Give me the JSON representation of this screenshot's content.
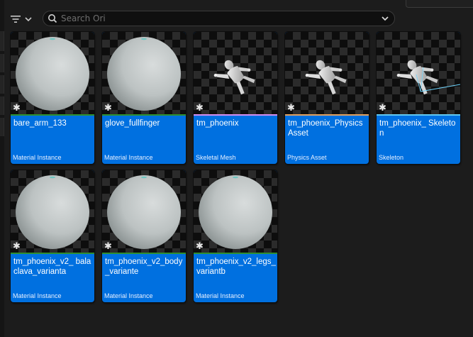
{
  "search": {
    "placeholder": "Search Ori",
    "value": ""
  },
  "toolbar": {
    "filter_icon": "filter-lines-icon",
    "dropdown_icon": "chevron-down-icon"
  },
  "colors": {
    "tile_bg": "#0070e0",
    "material_instance": "#2f8f2f",
    "skeletal_mesh": "#d48ef0",
    "physics_asset": "#e0a060",
    "skeleton": "#62c8f0"
  },
  "assets": [
    {
      "name": "bare_arm_133",
      "type": "Material Instance",
      "thumb": "sphere"
    },
    {
      "name": "glove_fullfinger",
      "type": "Material Instance",
      "thumb": "sphere"
    },
    {
      "name": "tm_phoenix",
      "type": "Skeletal Mesh",
      "thumb": "character"
    },
    {
      "name": "tm_phoenix_Physics Asset",
      "type": "Physics Asset",
      "thumb": "character"
    },
    {
      "name": "tm_phoenix_ Skeleton",
      "type": "Skeleton",
      "thumb": "skeleton"
    },
    {
      "name": "tm_phoenix_v2_ balaclava_varianta",
      "type": "Material Instance",
      "thumb": "sphere"
    },
    {
      "name": "tm_phoenix_v2_body _variante",
      "type": "Material Instance",
      "thumb": "sphere"
    },
    {
      "name": "tm_phoenix_v2_legs_ variantb",
      "type": "Material Instance",
      "thumb": "sphere"
    }
  ]
}
